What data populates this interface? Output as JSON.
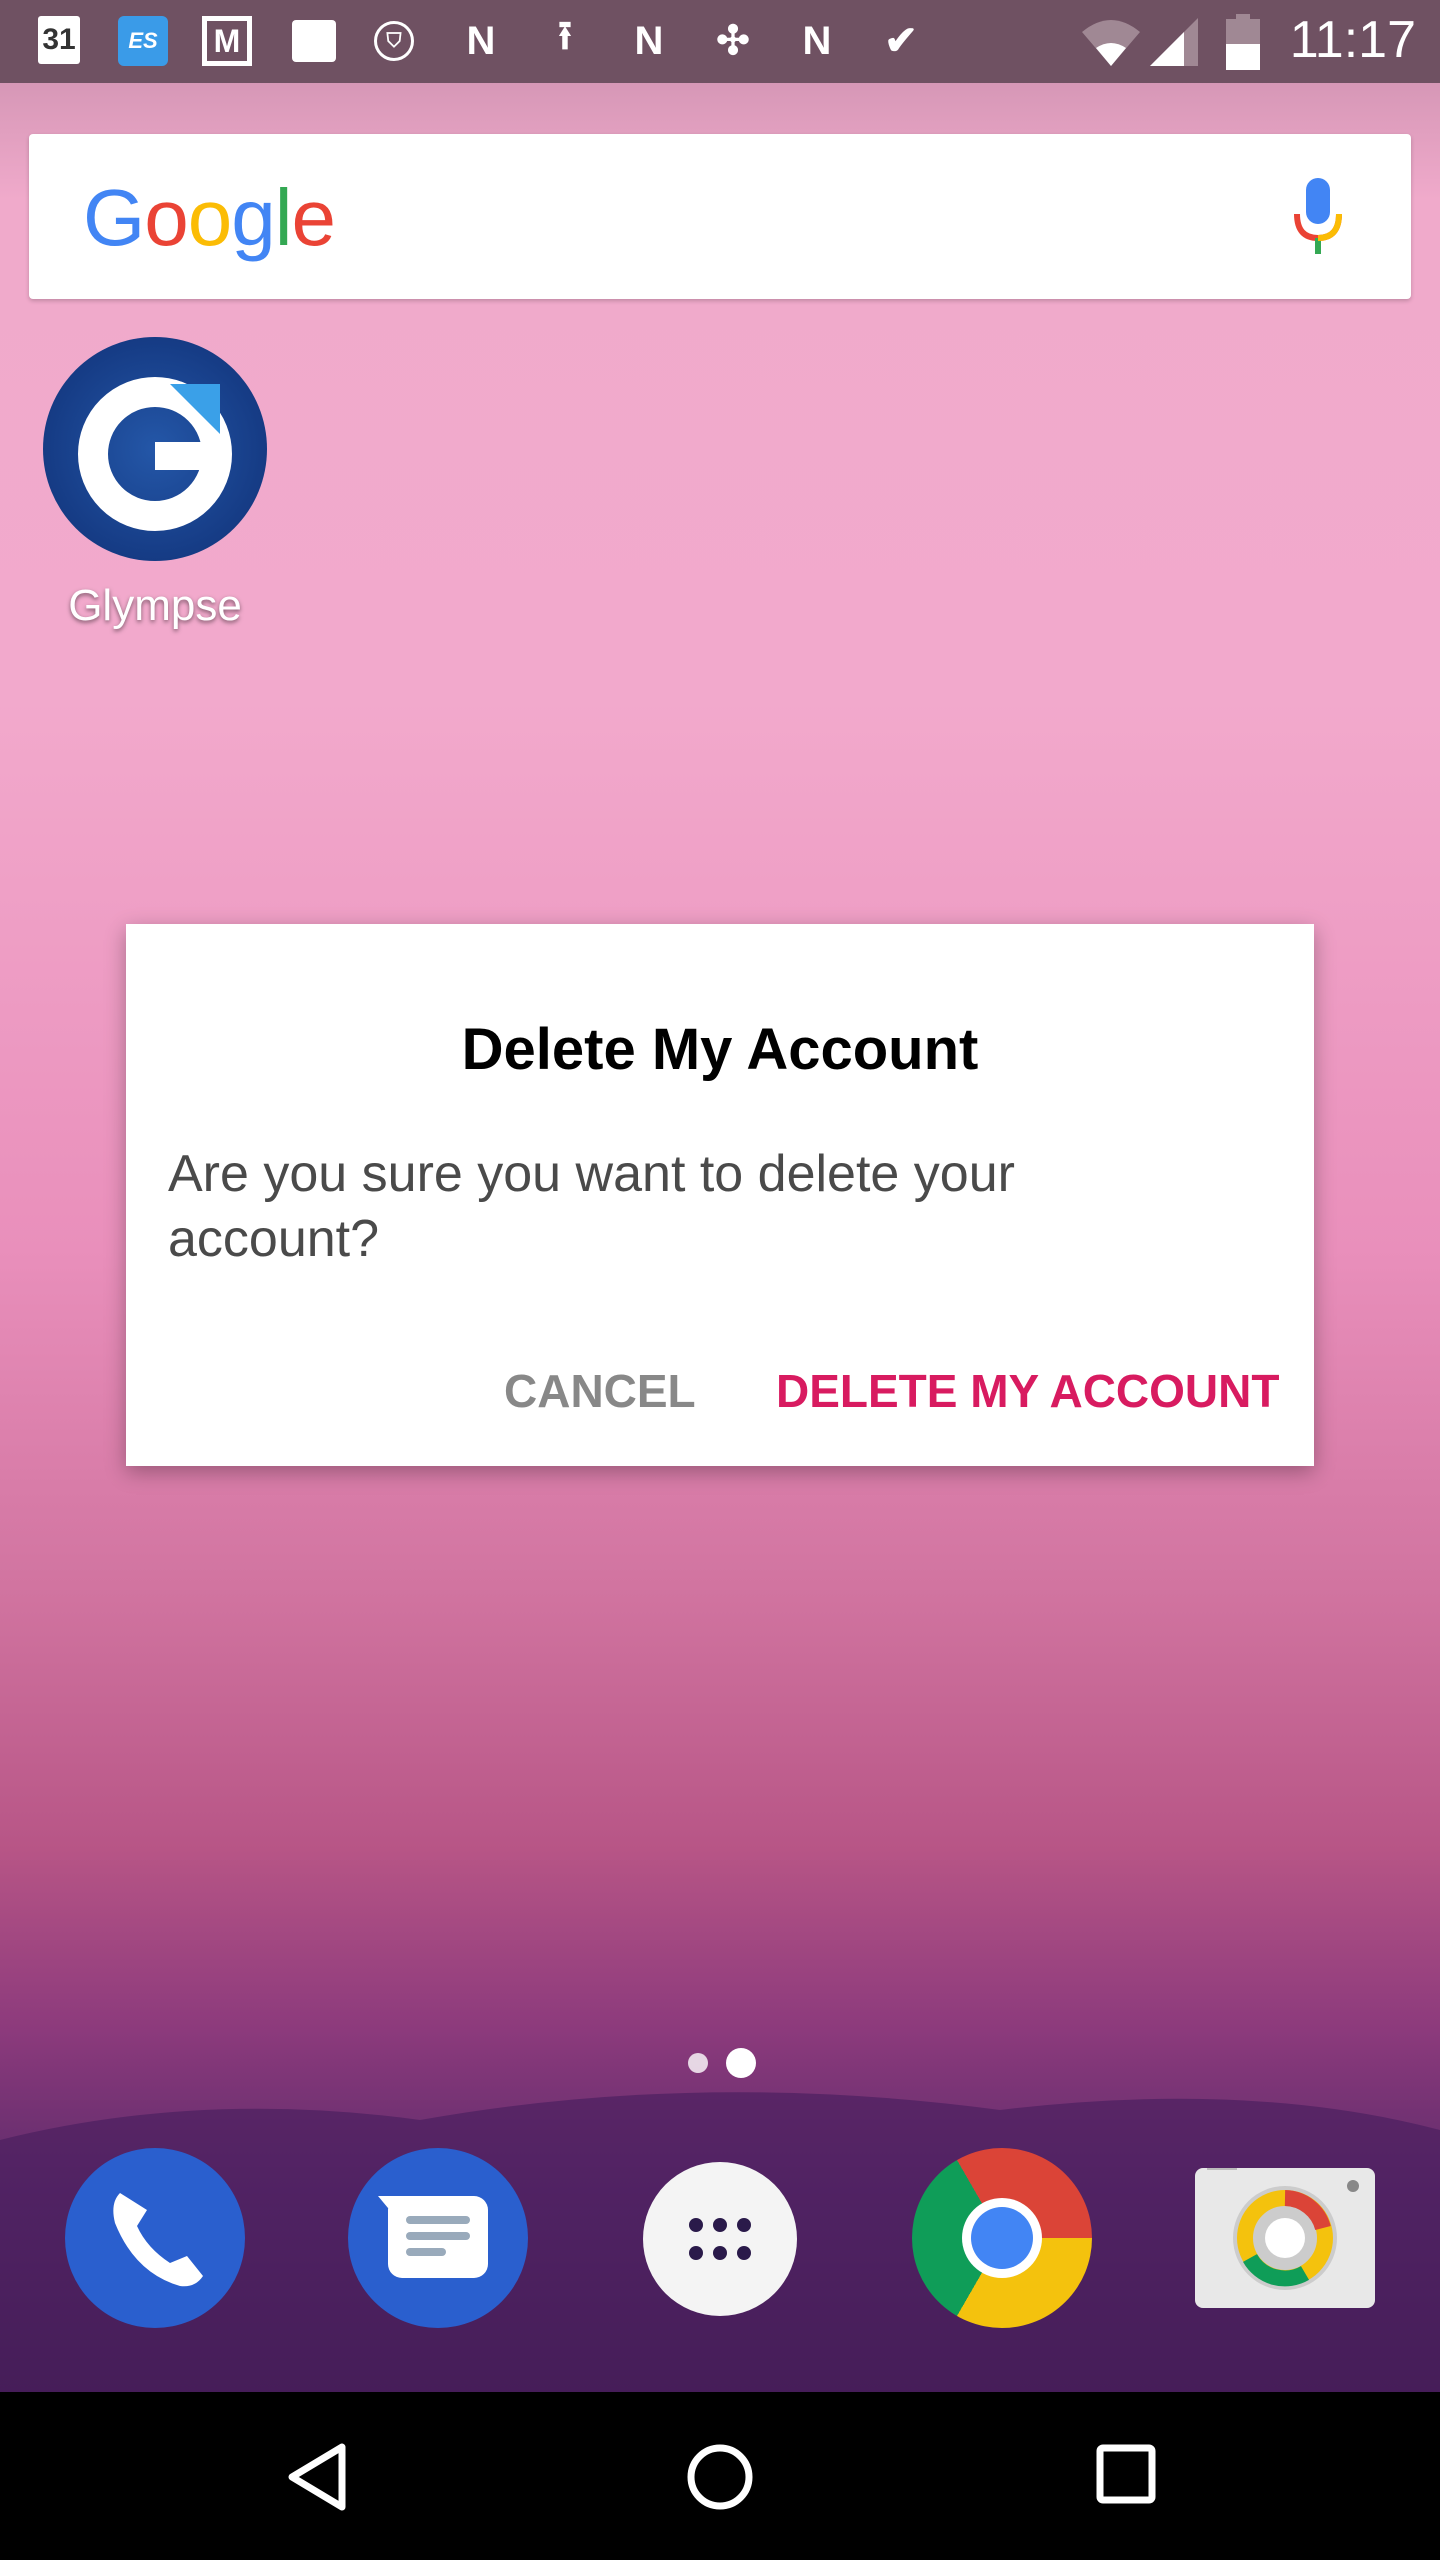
{
  "status_bar": {
    "time": "11:17",
    "calendar_date": "31",
    "notification_icons": [
      "calendar-icon",
      "es-file-explorer-icon",
      "gmail-icon",
      "photos-icon",
      "vpn-shield-icon",
      "n-app-icon",
      "upload-icon",
      "n-app-icon",
      "pinwheel-icon",
      "n-app-icon",
      "checkmark-app-icon"
    ],
    "system_icons": [
      "wifi-icon",
      "cell-signal-icon",
      "battery-icon"
    ]
  },
  "search": {
    "logo": "Google",
    "mic_icon": "mic-icon"
  },
  "home_apps": [
    {
      "label": "Glympse",
      "icon": "glympse-icon"
    }
  ],
  "dialog": {
    "title": "Delete My Account",
    "message": "Are you sure you want to delete your account?",
    "cancel": "CANCEL",
    "confirm": "DELETE MY ACCOUNT",
    "accent": "#d81b60"
  },
  "page_indicator": {
    "pages": 2,
    "current": 2
  },
  "dock": [
    "phone-icon",
    "messages-icon",
    "app-drawer-icon",
    "chrome-icon",
    "camera-icon"
  ],
  "nav": [
    "back-icon",
    "home-icon",
    "recents-icon"
  ]
}
